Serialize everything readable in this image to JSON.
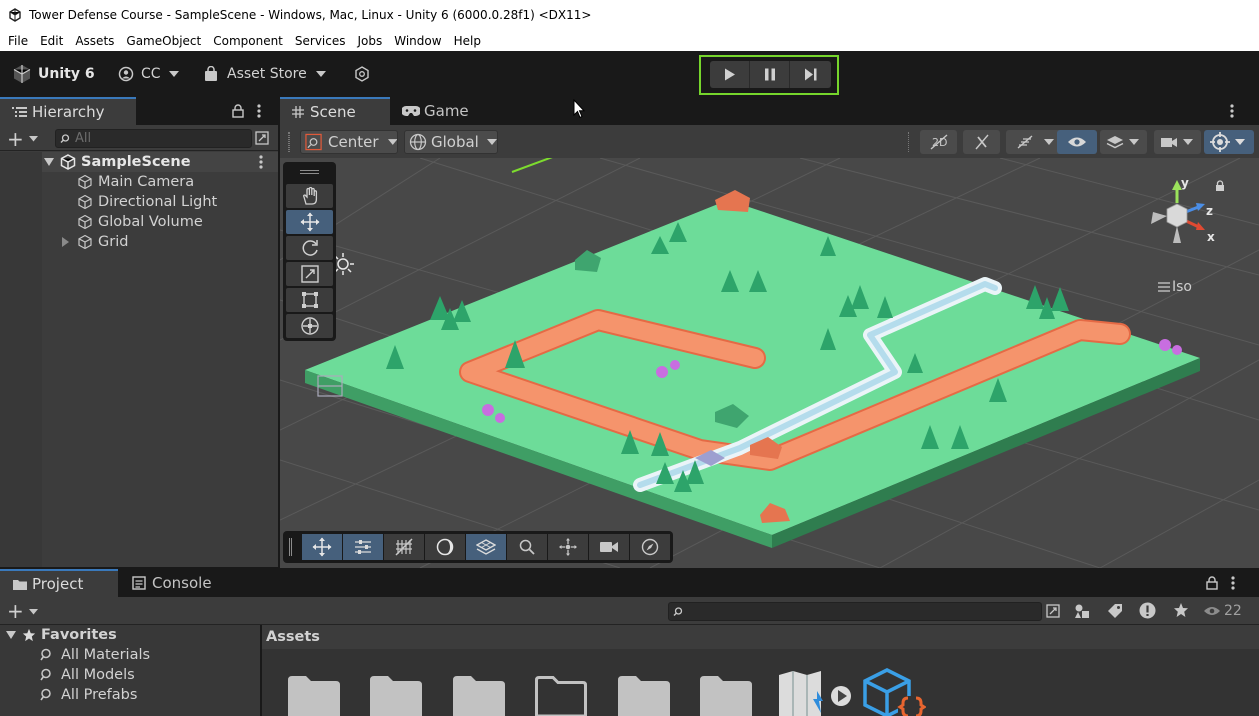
{
  "window": {
    "title": "Tower Defense Course - SampleScene - Windows, Mac, Linux - Unity 6 (6000.0.28f1) <DX11>"
  },
  "menu": [
    "File",
    "Edit",
    "Assets",
    "GameObject",
    "Component",
    "Services",
    "Jobs",
    "Window",
    "Help"
  ],
  "toolbar": {
    "unity_label": "Unity 6",
    "account_label": "CC",
    "asset_store_label": "Asset Store"
  },
  "hierarchy": {
    "tab_label": "Hierarchy",
    "search_placeholder": "All",
    "scene_name": "SampleScene",
    "items": [
      "Main Camera",
      "Directional Light",
      "Global Volume",
      "Grid"
    ]
  },
  "scene_tabs": {
    "scene_label": "Scene",
    "game_label": "Game"
  },
  "scene_toolbar": {
    "pivot_label": "Center",
    "space_label": "Global"
  },
  "gizmo": {
    "y": "y",
    "z": "z",
    "x": "x",
    "projection_label": "Iso"
  },
  "bottom_tabs": {
    "project_label": "Project",
    "console_label": "Console"
  },
  "project": {
    "favorites_label": "Favorites",
    "favorites": [
      "All Materials",
      "All Models",
      "All Prefabs"
    ],
    "assets_label": "Assets",
    "hidden_count": "22"
  },
  "colors": {
    "accent_green": "#76d52c",
    "selection_blue": "#46607c",
    "tab_highlight": "#3a79bb",
    "ground": "#6ddc99",
    "path": "#f0865e",
    "water": "#cfe9f2"
  }
}
